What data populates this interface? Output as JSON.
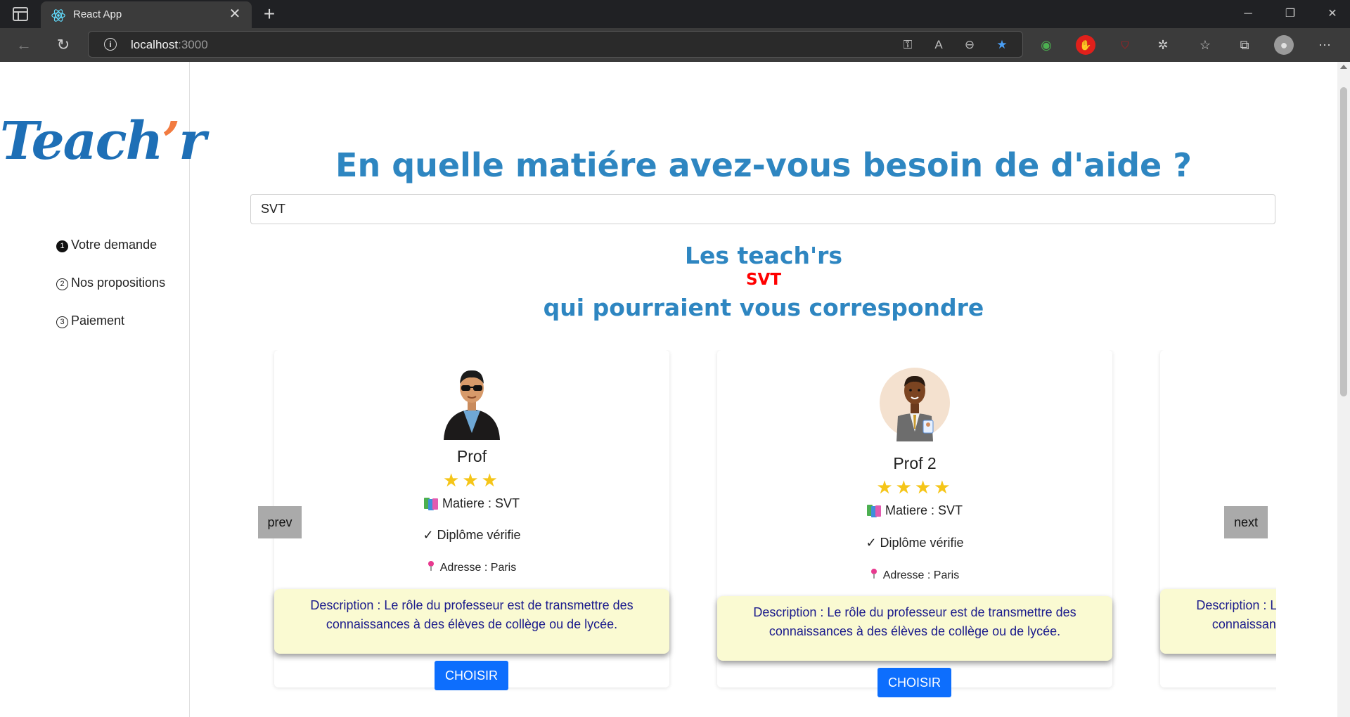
{
  "browser": {
    "tab_title": "React App",
    "url_host": "localhost",
    "url_port": ":3000"
  },
  "sidebar": {
    "logo_main": "Teach",
    "logo_apos": "’",
    "logo_end": "r",
    "steps": [
      {
        "num": "1",
        "label": "Votre demande",
        "active": true
      },
      {
        "num": "2",
        "label": "Nos propositions",
        "active": false
      },
      {
        "num": "3",
        "label": "Paiement",
        "active": false
      }
    ]
  },
  "main": {
    "title": "En quelle matiére avez-vous besoin de d'aide ?",
    "search_value": "SVT",
    "subtitle_1": "Les teach'rs",
    "subtitle_subject": "SVT",
    "subtitle_2": "qui pourraient vous correspondre",
    "prev_label": "prev",
    "next_label": "next"
  },
  "cards": [
    {
      "name": "Prof",
      "rating": 3,
      "stars": "★★★",
      "subject_label": "Matiere : SVT",
      "diploma": "✓ Diplôme vérifie",
      "address": "Adresse : Paris",
      "description": "Description : Le rôle du professeur est de transmettre des connaissances à des élèves de collège ou de lycée.",
      "button": "CHOISIR"
    },
    {
      "name": "Prof 2",
      "rating": 4,
      "stars": "★★★★",
      "subject_label": "Matiere : SVT",
      "diploma": "✓ Diplôme vérifie",
      "address": "Adresse : Paris",
      "description": "Description : Le rôle du professeur est de transmettre des connaissances à des élèves de collège ou de lycée.",
      "button": "CHOISIR"
    },
    {
      "description": "Description : Le rôle du professeur est de transmettre des connaissances à des élèves de collège ou de lycée."
    }
  ],
  "colors": {
    "accent_blue": "#2e86c1",
    "subject_red": "#ff0000",
    "button_blue": "#0d6efd",
    "description_bg": "#fafad2",
    "logo_orange": "#f27b40"
  }
}
